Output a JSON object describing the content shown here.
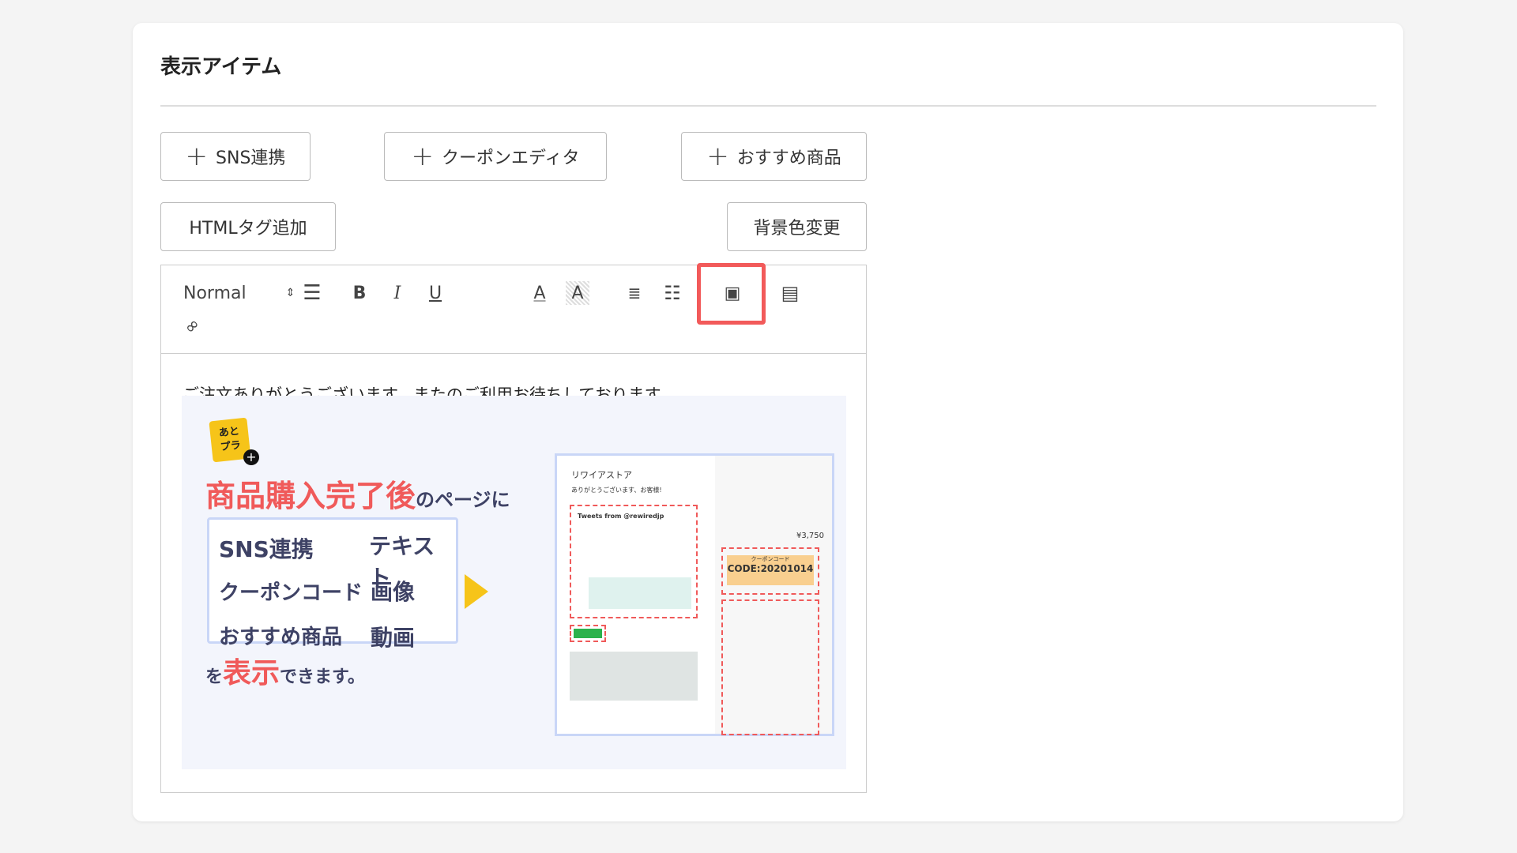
{
  "section_title": "表示アイテム",
  "buttons": {
    "sns": "SNS連携",
    "coupon": "クーポンエディタ",
    "recommend": "おすすめ商品",
    "html_tag": "HTMLタグ追加",
    "bg_color": "背景色変更"
  },
  "toolbar": {
    "format": "Normal",
    "icons": [
      "align-icon",
      "bold-icon",
      "italic-icon",
      "underline-icon",
      "font-color-icon",
      "background-color-icon",
      "ordered-list-icon",
      "bullet-list-icon",
      "image-icon",
      "video-icon",
      "link-icon"
    ],
    "highlight_color": "#f25a5a"
  },
  "content": {
    "message": "ご注文ありがとうございます。またのご利用お待ちしております。",
    "promo": {
      "logo_text": "あとプラ",
      "headline_red": "商品購入完了後",
      "headline_rest": "のページに",
      "items": [
        "SNS連携",
        "テキスト",
        "クーポンコード",
        "画像",
        "おすすめ商品",
        "動画"
      ],
      "footer_pre": "を",
      "footer_red": "表示",
      "footer_post": "できます。",
      "mock": {
        "store": "リワイアストア",
        "thanks": "ありがとうございます、お客様!",
        "tweets": "Tweets from @rewiredjp",
        "coupon_label": "クーポンコード",
        "coupon_code": "CODE:20201014",
        "total": "¥3,750"
      }
    }
  }
}
